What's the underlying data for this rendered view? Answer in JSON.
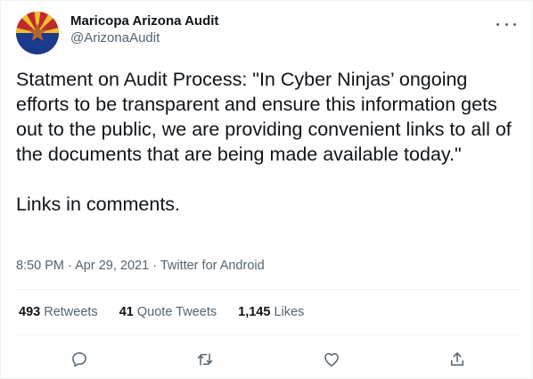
{
  "tweet": {
    "author": {
      "display_name": "Maricopa Arizona Audit",
      "handle": "@ArizonaAudit",
      "avatar_icon": "arizona-flag-avatar"
    },
    "text": "Statment on Audit Process: \"In Cyber Ninjas’ ongoing efforts to be transparent and ensure this information gets out to the public, we are providing convenient links to all of the documents that are being made available today.\"\n\nLinks in comments.",
    "meta": {
      "time": "8:50 PM",
      "separator": "·",
      "date": "Apr 29, 2021",
      "source": "Twitter for Android"
    },
    "stats": {
      "retweets_count": "493",
      "retweets_label": "Retweets",
      "quotes_count": "41",
      "quotes_label": "Quote Tweets",
      "likes_count": "1,145",
      "likes_label": "Likes"
    },
    "actions": [
      "reply-icon",
      "retweet-icon",
      "like-icon",
      "share-icon"
    ]
  },
  "colors": {
    "text": "#0f1419",
    "secondary": "#536471",
    "border": "#eff3f4",
    "flag_red": "#bf2a2a",
    "flag_yellow": "#f2c12e",
    "flag_blue": "#1b3a8c",
    "flag_copper": "#b8652a"
  }
}
